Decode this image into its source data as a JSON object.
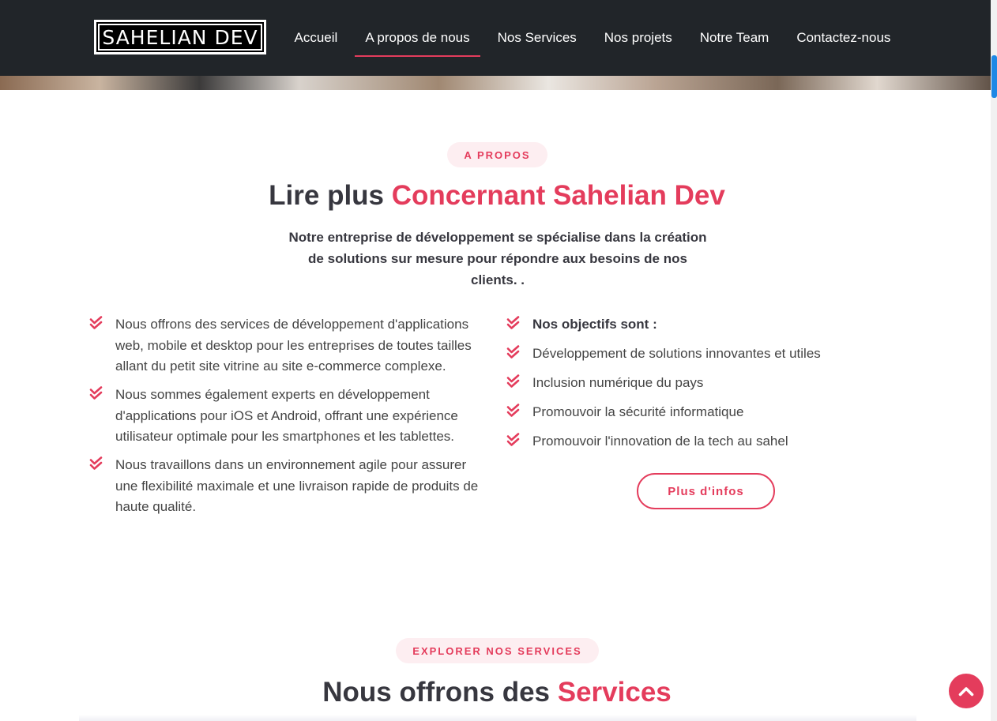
{
  "header": {
    "logo_text": "SAHELIAN DEV",
    "nav": [
      {
        "label": "Accueil",
        "active": false
      },
      {
        "label": "A propos de nous",
        "active": true
      },
      {
        "label": "Nos Services",
        "active": false
      },
      {
        "label": "Nos projets",
        "active": false
      },
      {
        "label": "Notre Team",
        "active": false
      },
      {
        "label": "Contactez-nous",
        "active": false
      }
    ]
  },
  "about": {
    "badge": "A PROPOS",
    "title_main": "Lire plus",
    "title_accent": "Concernant Sahelian Dev",
    "lead": "Notre entreprise de développement se spécialise dans la création de solutions sur mesure pour répondre aux besoins de nos clients. .",
    "left_items": [
      "Nous offrons des services de développement d'applications web, mobile et desktop pour les entreprises de toutes tailles allant du petit site vitrine au site e-commerce complexe.",
      "Nous sommes également experts en développement d'applications pour iOS et Android, offrant une expérience utilisateur optimale pour les smartphones et les tablettes.",
      "Nous travaillons dans un environnement agile pour assurer une flexibilité maximale et une livraison rapide de produits de haute qualité."
    ],
    "right_heading": "Nos objectifs sont :",
    "right_items": [
      "Développement de solutions innovantes et utiles",
      "Inclusion numérique du pays",
      "Promouvoir la sécurité informatique",
      "Promouvoir l'innovation de la tech au sahel"
    ],
    "button_label": "Plus d'infos"
  },
  "services": {
    "badge": "EXPLORER NOS SERVICES",
    "title_main": "Nous offrons des",
    "title_accent": "Services"
  },
  "icons": {
    "check": "double-check-icon",
    "back_to_top": "chevron-up-icon"
  },
  "colors": {
    "accent": "#e43c5c",
    "header_bg": "#212529",
    "pill_bg": "#fdeef1",
    "text_dark": "#37373f"
  }
}
